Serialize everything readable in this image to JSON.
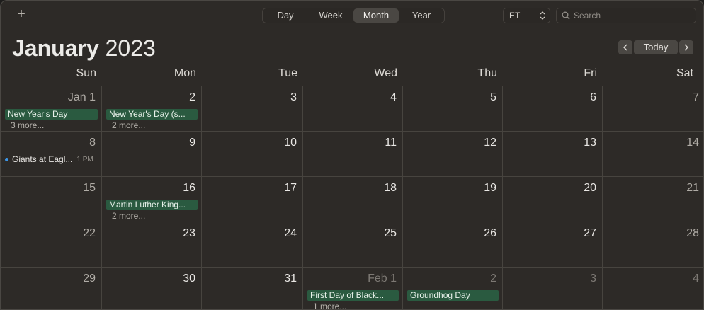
{
  "toolbar": {
    "add_label": "+",
    "views": [
      "Day",
      "Week",
      "Month",
      "Year"
    ],
    "active_view": "Month",
    "timezone": "ET",
    "search_placeholder": "Search"
  },
  "header": {
    "month": "January",
    "year": "2023",
    "today_label": "Today"
  },
  "weekdays": [
    "Sun",
    "Mon",
    "Tue",
    "Wed",
    "Thu",
    "Fri",
    "Sat"
  ],
  "weeks": [
    [
      {
        "day": "Jan 1",
        "events": [
          {
            "title": "New Year's Day"
          }
        ],
        "more": "3 more..."
      },
      {
        "day": "2",
        "events": [
          {
            "title": "New Year's Day (s..."
          }
        ],
        "more": "2 more..."
      },
      {
        "day": "3"
      },
      {
        "day": "4"
      },
      {
        "day": "5"
      },
      {
        "day": "6"
      },
      {
        "day": "7"
      }
    ],
    [
      {
        "day": "8",
        "timed": [
          {
            "title": "Giants at Eagl...",
            "time": "1 PM"
          }
        ]
      },
      {
        "day": "9"
      },
      {
        "day": "10"
      },
      {
        "day": "11"
      },
      {
        "day": "12"
      },
      {
        "day": "13"
      },
      {
        "day": "14"
      }
    ],
    [
      {
        "day": "15"
      },
      {
        "day": "16",
        "events": [
          {
            "title": "Martin Luther King..."
          }
        ],
        "more": "2 more..."
      },
      {
        "day": "17"
      },
      {
        "day": "18"
      },
      {
        "day": "19"
      },
      {
        "day": "20"
      },
      {
        "day": "21"
      }
    ],
    [
      {
        "day": "22"
      },
      {
        "day": "23"
      },
      {
        "day": "24"
      },
      {
        "day": "25"
      },
      {
        "day": "26"
      },
      {
        "day": "27"
      },
      {
        "day": "28"
      }
    ],
    [
      {
        "day": "29"
      },
      {
        "day": "30"
      },
      {
        "day": "31"
      },
      {
        "day": "Feb 1",
        "other": true,
        "events": [
          {
            "title": "First Day of Black..."
          }
        ],
        "more": "1 more..."
      },
      {
        "day": "2",
        "other": true,
        "events": [
          {
            "title": "Groundhog Day"
          }
        ]
      },
      {
        "day": "3",
        "other": true
      },
      {
        "day": "4",
        "other": true
      }
    ]
  ],
  "colors": {
    "background": "#2d2a27",
    "holiday_event": "#2a5a40",
    "timed_event_dot": "#3c95e6"
  }
}
